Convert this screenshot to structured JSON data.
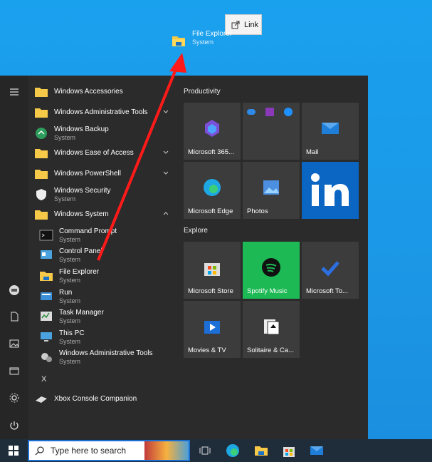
{
  "drag": {
    "title": "File Explorer",
    "subtitle": "System",
    "tooltip": "Link"
  },
  "applist": {
    "items": [
      {
        "label": "Windows Accessories",
        "sub": ""
      },
      {
        "label": "Windows Administrative Tools",
        "sub": ""
      },
      {
        "label": "Windows Backup",
        "sub": "System"
      },
      {
        "label": "Windows Ease of Access",
        "sub": ""
      },
      {
        "label": "Windows PowerShell",
        "sub": ""
      },
      {
        "label": "Windows Security",
        "sub": "System"
      },
      {
        "label": "Windows System",
        "sub": ""
      },
      {
        "label": "Command Prompt",
        "sub": "System"
      },
      {
        "label": "Control Panel",
        "sub": "System"
      },
      {
        "label": "File Explorer",
        "sub": "System"
      },
      {
        "label": "Run",
        "sub": "System"
      },
      {
        "label": "Task Manager",
        "sub": "System"
      },
      {
        "label": "This PC",
        "sub": "System"
      },
      {
        "label": "Windows Administrative Tools",
        "sub": "System"
      },
      {
        "label": "Xbox Console Companion",
        "sub": ""
      }
    ],
    "letter_x": "X"
  },
  "tiles": {
    "productivity_title": "Productivity",
    "explore_title": "Explore",
    "items": [
      {
        "label": "Microsoft 365...",
        "color": "#3c3c3c"
      },
      {
        "label": "",
        "color": "#3c3c3c"
      },
      {
        "label": "Mail",
        "color": "#3c3c3c"
      },
      {
        "label": "Microsoft Edge",
        "color": "#3c3c3c"
      },
      {
        "label": "Photos",
        "color": "#3c3c3c"
      },
      {
        "label": "",
        "color": "#0a66c2"
      },
      {
        "label": "Microsoft Store",
        "color": "#3c3c3c"
      },
      {
        "label": "Spotify Music",
        "color": "#1db954"
      },
      {
        "label": "Microsoft To...",
        "color": "#3c3c3c"
      },
      {
        "label": "Movies & TV",
        "color": "#3c3c3c"
      },
      {
        "label": "Solitaire & Ca...",
        "color": "#3c3c3c"
      }
    ]
  },
  "taskbar": {
    "search_placeholder": "Type here to search"
  }
}
